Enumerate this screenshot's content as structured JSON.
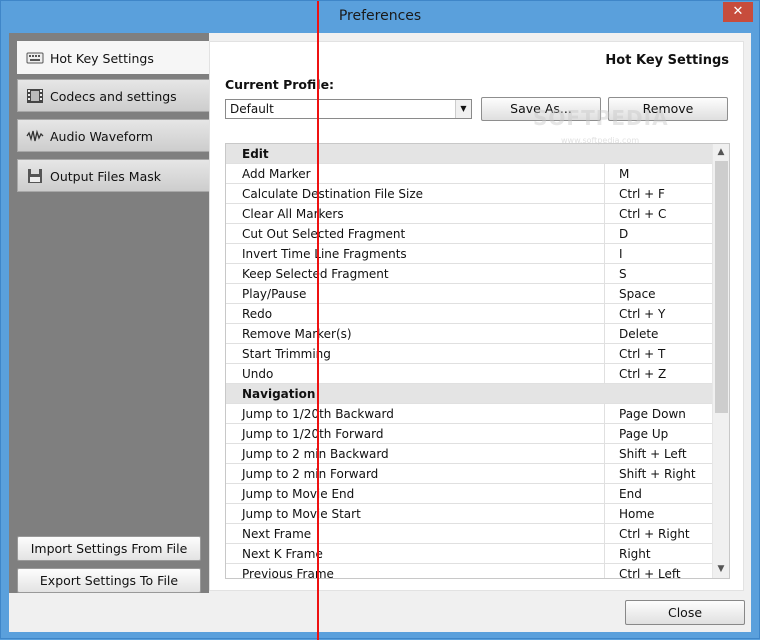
{
  "window": {
    "title": "Preferences",
    "close_glyph": "✕"
  },
  "sidebar": {
    "items": [
      {
        "label": "Hot Key Settings",
        "icon": "keyboard-icon",
        "active": true
      },
      {
        "label": "Codecs and settings",
        "icon": "film-icon",
        "active": false
      },
      {
        "label": "Audio Waveform",
        "icon": "waveform-icon",
        "active": false
      },
      {
        "label": "Output Files Mask",
        "icon": "floppy-icon",
        "active": false
      }
    ],
    "import_label": "Import Settings From File",
    "export_label": "Export Settings To File"
  },
  "panel": {
    "title": "Hot Key Settings",
    "profile_label": "Current Profile:",
    "profile_value": "Default",
    "save_as_label": "Save As...",
    "remove_label": "Remove"
  },
  "hotkeys": [
    {
      "group": "Edit"
    },
    {
      "action": "Add Marker",
      "key": "M"
    },
    {
      "action": "Calculate Destination File Size",
      "key": "Ctrl + F"
    },
    {
      "action": "Clear All Markers",
      "key": "Ctrl + C"
    },
    {
      "action": "Cut Out Selected Fragment",
      "key": "D"
    },
    {
      "action": "Invert Time Line Fragments",
      "key": "I"
    },
    {
      "action": "Keep Selected Fragment",
      "key": "S"
    },
    {
      "action": "Play/Pause",
      "key": "Space"
    },
    {
      "action": "Redo",
      "key": "Ctrl + Y"
    },
    {
      "action": "Remove Marker(s)",
      "key": "Delete"
    },
    {
      "action": "Start Trimming",
      "key": "Ctrl + T"
    },
    {
      "action": "Undo",
      "key": "Ctrl + Z"
    },
    {
      "group": "Navigation"
    },
    {
      "action": "Jump to 1/20th Backward",
      "key": "Page Down"
    },
    {
      "action": "Jump to 1/20th Forward",
      "key": "Page Up"
    },
    {
      "action": "Jump to 2 min Backward",
      "key": "Shift + Left"
    },
    {
      "action": "Jump to 2 min Forward",
      "key": "Shift + Right"
    },
    {
      "action": "Jump to Movie End",
      "key": "End"
    },
    {
      "action": "Jump to Movie Start",
      "key": "Home"
    },
    {
      "action": "Next Frame",
      "key": "Ctrl + Right"
    },
    {
      "action": "Next K Frame",
      "key": "Right"
    },
    {
      "action": "Previous Frame",
      "key": "Ctrl + Left"
    }
  ],
  "footer": {
    "close_label": "Close"
  },
  "watermark": {
    "text": "SOFTPEDIA",
    "sub": "www.softpedia.com"
  },
  "colors": {
    "window_frame": "#5aa0dc",
    "sidebar_bg": "#7f7f7f",
    "group_row": "#e4e4e4",
    "marker_line": "#ee1111"
  }
}
